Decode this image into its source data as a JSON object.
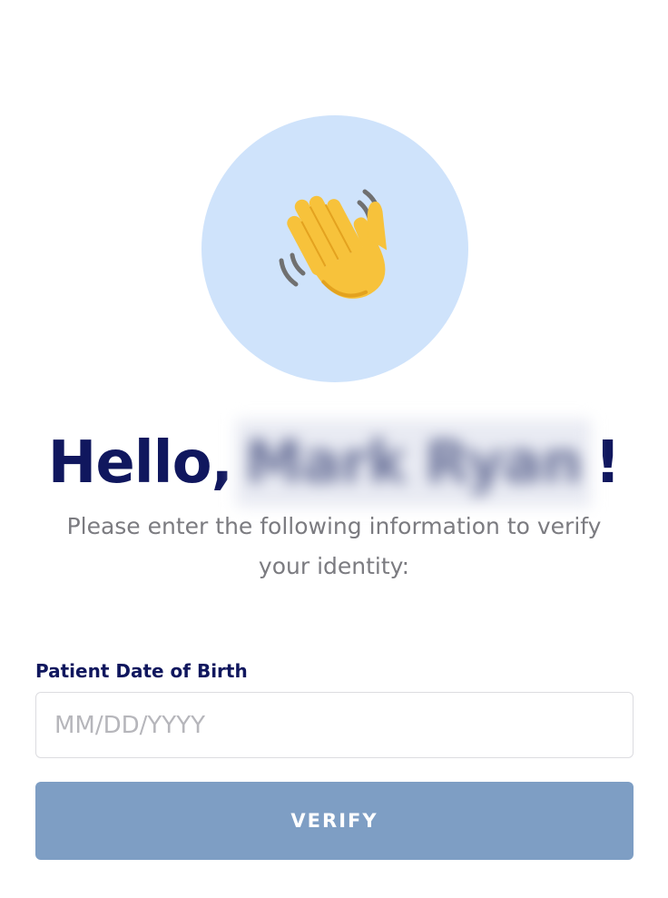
{
  "hero": {
    "icon": "waving-hand-icon",
    "circle_color": "#cfe3fb"
  },
  "greeting": {
    "prefix": "Hello,",
    "name": "Mark Ryan",
    "suffix": "!"
  },
  "instructions": {
    "text": "Please enter the following information to verify your identity:"
  },
  "form": {
    "dob_label": "Patient Date of Birth",
    "dob_placeholder": "MM/DD/YYYY",
    "dob_value": ""
  },
  "verify_button": {
    "label": "VERIFY",
    "color": "#7e9ec4"
  },
  "colors": {
    "heading": "#10175e",
    "body_text": "#7b7b80"
  }
}
